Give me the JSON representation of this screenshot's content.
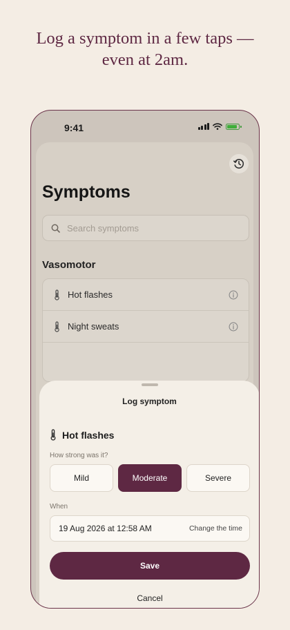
{
  "headline": {
    "line1": "Log a symptom in a few taps —",
    "line2": "even at 2am."
  },
  "status_bar": {
    "time": "9:41"
  },
  "screen": {
    "title": "Symptoms",
    "history_icon": "history-icon",
    "search": {
      "placeholder": "Search symptoms",
      "value": ""
    },
    "section": "Vasomotor",
    "items": [
      {
        "label": "Hot flashes",
        "icon": "thermometer-icon"
      },
      {
        "label": "Night sweats",
        "icon": "thermometer-icon"
      }
    ]
  },
  "sheet": {
    "title": "Log symptom",
    "symptom": "Hot flashes",
    "question": "How strong was it?",
    "severity_options": [
      "Mild",
      "Moderate",
      "Severe"
    ],
    "selected_severity": "Moderate",
    "when_label": "When",
    "date_value": "19 Aug 2026 at 12:58 AM",
    "change_time": "Change the time",
    "save": "Save",
    "cancel": "Cancel"
  },
  "colors": {
    "accent": "#5e2843",
    "background": "#f4ede4",
    "sheet_background": "#f4efe7",
    "battery": "#3fae3a"
  }
}
